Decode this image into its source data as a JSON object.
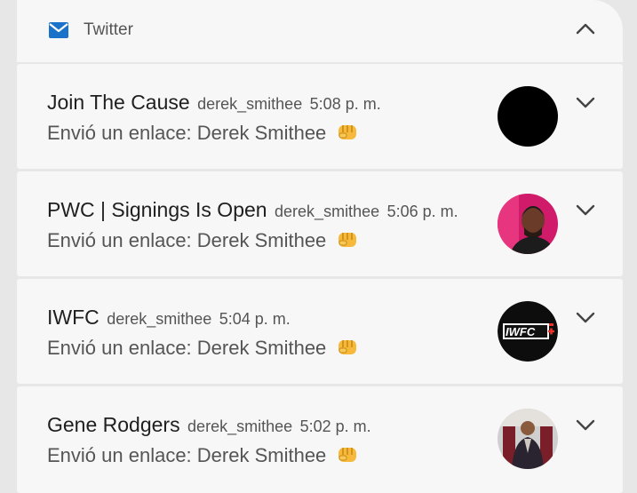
{
  "group": {
    "app_name": "Twitter"
  },
  "notifications": [
    {
      "title": "Join The Cause",
      "handle": "derek_smithee",
      "time": "5:08 p. m.",
      "body": "Envió un enlace: Derek Smithee",
      "avatar": "black-circle"
    },
    {
      "title": "PWC | Signings Is Open",
      "handle": "derek_smithee",
      "time": "5:06 p. m.",
      "body": "Envió un enlace: Derek Smithee",
      "avatar": "pink-portrait"
    },
    {
      "title": "IWFC",
      "handle": "derek_smithee",
      "time": "5:04 p. m.",
      "body": "Envió un enlace: Derek Smithee",
      "avatar": "iwfc-logo",
      "logo_text": "IWFC"
    },
    {
      "title": "Gene Rodgers",
      "handle": "derek_smithee",
      "time": "5:02 p. m.",
      "body": "Envió un enlace: Derek Smithee",
      "avatar": "man-photo"
    }
  ],
  "icons": {
    "app": "mail-icon",
    "collapse": "chevron-up-icon",
    "expand": "chevron-down-icon",
    "emoji": "fist-emoji-icon"
  },
  "colors": {
    "app_icon": "#1a73c9",
    "card": "#f7f7f7",
    "background": "#e7e7e7"
  }
}
